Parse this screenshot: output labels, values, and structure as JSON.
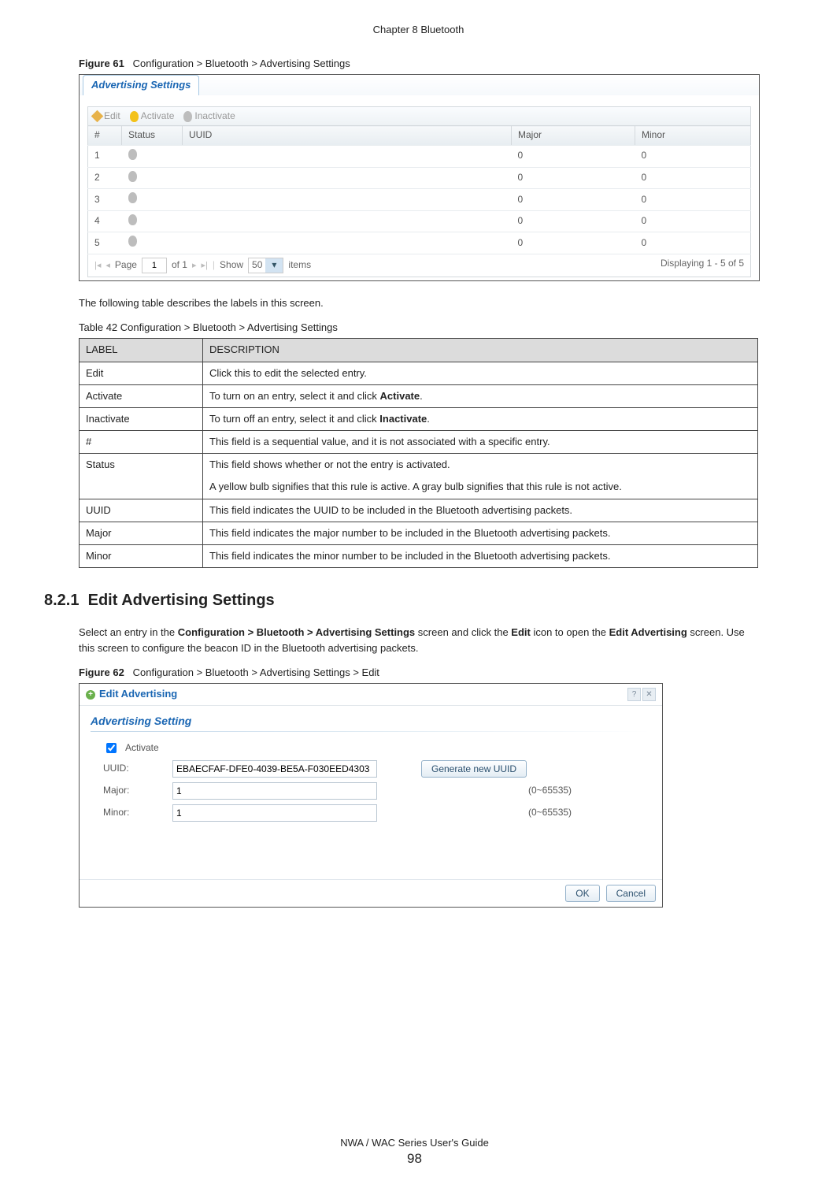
{
  "chapterHeader": "Chapter 8 Bluetooth",
  "fig61": {
    "label": "Figure 61",
    "caption": "Configuration > Bluetooth > Advertising Settings"
  },
  "shot1": {
    "tab": "Advertising Settings",
    "toolbar": {
      "edit": "Edit",
      "activate": "Activate",
      "inactivate": "Inactivate"
    },
    "headers": {
      "num": "#",
      "status": "Status",
      "uuid": "UUID",
      "major": "Major",
      "minor": "Minor"
    },
    "rows": [
      {
        "n": "1",
        "uuid": "",
        "major": "0",
        "minor": "0"
      },
      {
        "n": "2",
        "uuid": "",
        "major": "0",
        "minor": "0"
      },
      {
        "n": "3",
        "uuid": "",
        "major": "0",
        "minor": "0"
      },
      {
        "n": "4",
        "uuid": "",
        "major": "0",
        "minor": "0"
      },
      {
        "n": "5",
        "uuid": "",
        "major": "0",
        "minor": "0"
      }
    ],
    "pager": {
      "page": "Page",
      "pageNum": "1",
      "of": "of 1",
      "show": "Show",
      "showNum": "50",
      "items": "items",
      "displaying": "Displaying 1 - 5 of 5"
    }
  },
  "introText": "The following table describes the labels in this screen.",
  "table42": {
    "caption": "Table 42   Configuration > Bluetooth > Advertising Settings",
    "head": {
      "label": "LABEL",
      "desc": "DESCRIPTION"
    },
    "rows": [
      {
        "l": "Edit",
        "d": "Click this to edit the selected entry."
      },
      {
        "l": "Activate",
        "d_pre": "To turn on an entry, select it and click ",
        "d_bold": "Activate",
        "d_post": "."
      },
      {
        "l": "Inactivate",
        "d_pre": "To turn off an entry, select it and click ",
        "d_bold": "Inactivate",
        "d_post": "."
      },
      {
        "l": "#",
        "d": "This field is a sequential value, and it is not associated with a specific entry."
      },
      {
        "l": "Status",
        "d": "This field shows whether or not the entry is activated.",
        "d2": "A yellow bulb signifies that this rule is active. A gray bulb signifies that this rule is not active."
      },
      {
        "l": "UUID",
        "d": "This field indicates the UUID to be included in the Bluetooth advertising packets."
      },
      {
        "l": "Major",
        "d": "This field indicates the major number to be included in the Bluetooth advertising packets."
      },
      {
        "l": "Minor",
        "d": "This field indicates the minor number to be included in the Bluetooth advertising packets."
      }
    ]
  },
  "section": {
    "num": "8.2.1",
    "title": "Edit Advertising Settings",
    "para_pre": "Select an entry in the ",
    "b1": "Configuration > Bluetooth > Advertising Settings",
    "mid1": " screen and click the ",
    "b2": "Edit",
    "mid2": " icon to open the ",
    "b3": "Edit Advertising",
    "post": " screen. Use this screen to configure the beacon ID in the Bluetooth advertising packets."
  },
  "fig62": {
    "label": "Figure 62",
    "caption": "Configuration > Bluetooth > Advertising Settings > Edit"
  },
  "shot2": {
    "title": "Edit Advertising",
    "sect": "Advertising Setting",
    "activate": "Activate",
    "uuidLabel": "UUID:",
    "uuidVal": "EBAECFAF-DFE0-4039-BE5A-F030EED4303",
    "genBtn": "Generate new UUID",
    "majorLabel": "Major:",
    "majorVal": "1",
    "majorHint": "(0~65535)",
    "minorLabel": "Minor:",
    "minorVal": "1",
    "minorHint": "(0~65535)",
    "ok": "OK",
    "cancel": "Cancel"
  },
  "footer": {
    "guide": "NWA / WAC Series User's Guide",
    "page": "98"
  }
}
